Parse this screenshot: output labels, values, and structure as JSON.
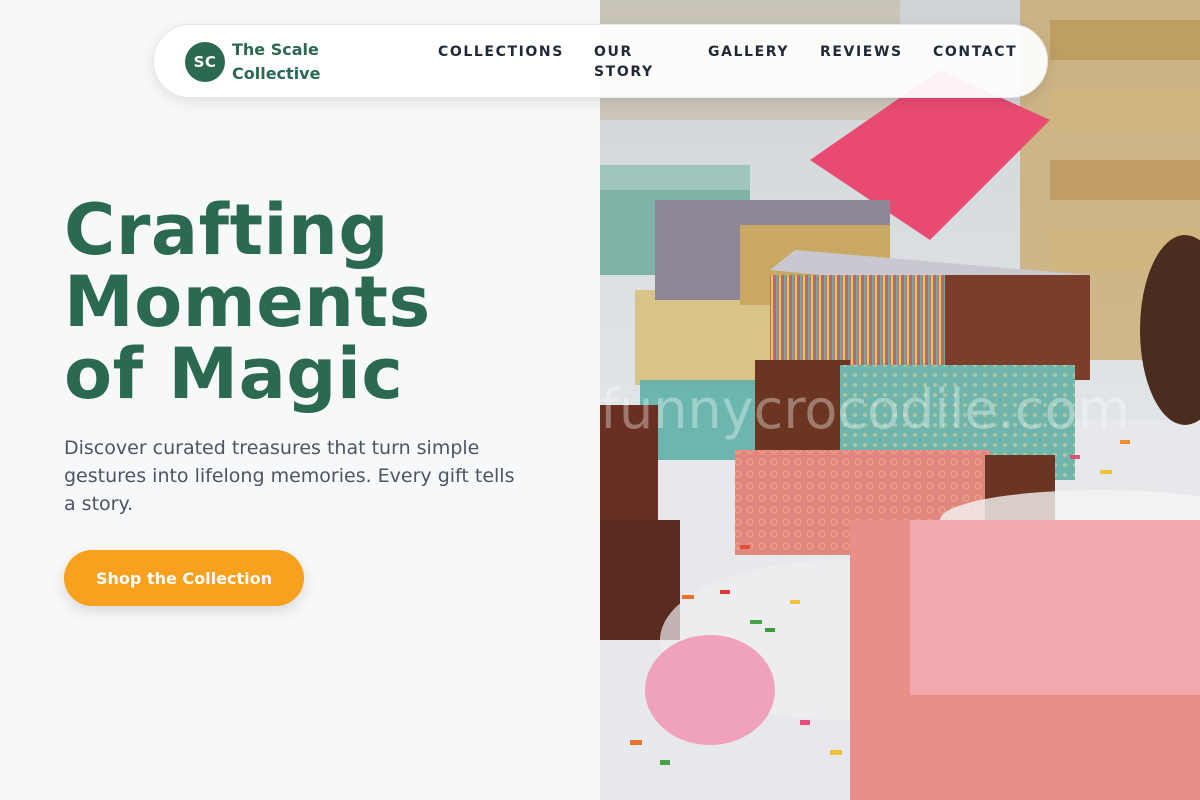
{
  "brand": {
    "initials": "SC",
    "name": "The Scale Collective"
  },
  "nav": {
    "collections": "COLLECTIONS",
    "our_story": "OUR STORY",
    "gallery": "GALLERY",
    "reviews": "REVIEWS",
    "contact": "CONTACT"
  },
  "hero": {
    "title": "Crafting Moments of Magic",
    "subtitle": "Discover curated treasures that turn simple gestures into lifelong memories. Every gift tells a story.",
    "cta_label": "Shop the Collection",
    "watermark": "funnycrocodile.com"
  },
  "colors": {
    "brand_green": "#2b6a50",
    "accent_orange": "#f9a01e",
    "text_dark": "#1f2937",
    "text_muted": "#4b5563"
  }
}
